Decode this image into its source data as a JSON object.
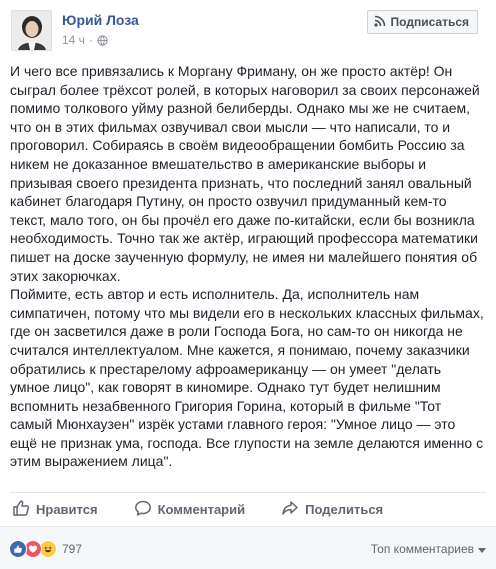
{
  "post": {
    "author": "Юрий Лоза",
    "time": "14 ч",
    "dot": "·",
    "subscribe_label": "Подписаться",
    "paragraphs": [
      "И чего все привязались к Моргану Фриману, он же просто актёр! Он сыграл более трёхсот ролей, в которых наговорил за своих персонажей помимо толкового уйму разной белиберды. Однако мы же не считаем, что он в этих фильмах озвучивал свои мысли — что написали, то и проговорил. Собираясь в своём видеообращении бомбить Россию за никем не доказанное вмешательство в американские выборы и призывая своего президента признать, что последний занял овальный кабинет благодаря Путину, он просто озвучил придуманный кем-то текст, мало того, он бы прочёл его даже по-китайски, если бы возникла необходимость. Точно так же актёр, играющий профессора математики пишет на доске заученную формулу, не имея ни малейшего понятия об этих закорючках.",
      "Поймите, есть автор и есть исполнитель. Да, исполнитель нам симпатичен, потому что мы видели его в нескольких классных фильмах, где он засветился даже в роли Господа Бога, но сам-то он никогда не считался интеллектуалом. Мне кажется, я понимаю, почему заказчики обратились к престарелому афроамериканцу — он умеет \"делать умное лицо\", как говорят в киномире. Однако тут будет нелишним вспомнить незабвенного Григория Горина, который в фильме \"Тот самый Мюнхаузен\" изрёк устами главного героя: \"Умное лицо — это ещё не признак ума, господа. Все глупости на земле делаются именно с этим выражением лица\"."
    ]
  },
  "actions": {
    "like": "Нравится",
    "comment": "Комментарий",
    "share": "Поделиться"
  },
  "reactions": {
    "count": "797",
    "icons": [
      "like-icon",
      "love-icon",
      "haha-icon"
    ],
    "top_comments_label": "Топ комментариев"
  },
  "colors": {
    "link": "#365899",
    "muted": "#90949c",
    "action": "#606770",
    "like_blue": "#4267b2",
    "love_red": "#f25268",
    "haha_yellow": "#fcca3e"
  }
}
